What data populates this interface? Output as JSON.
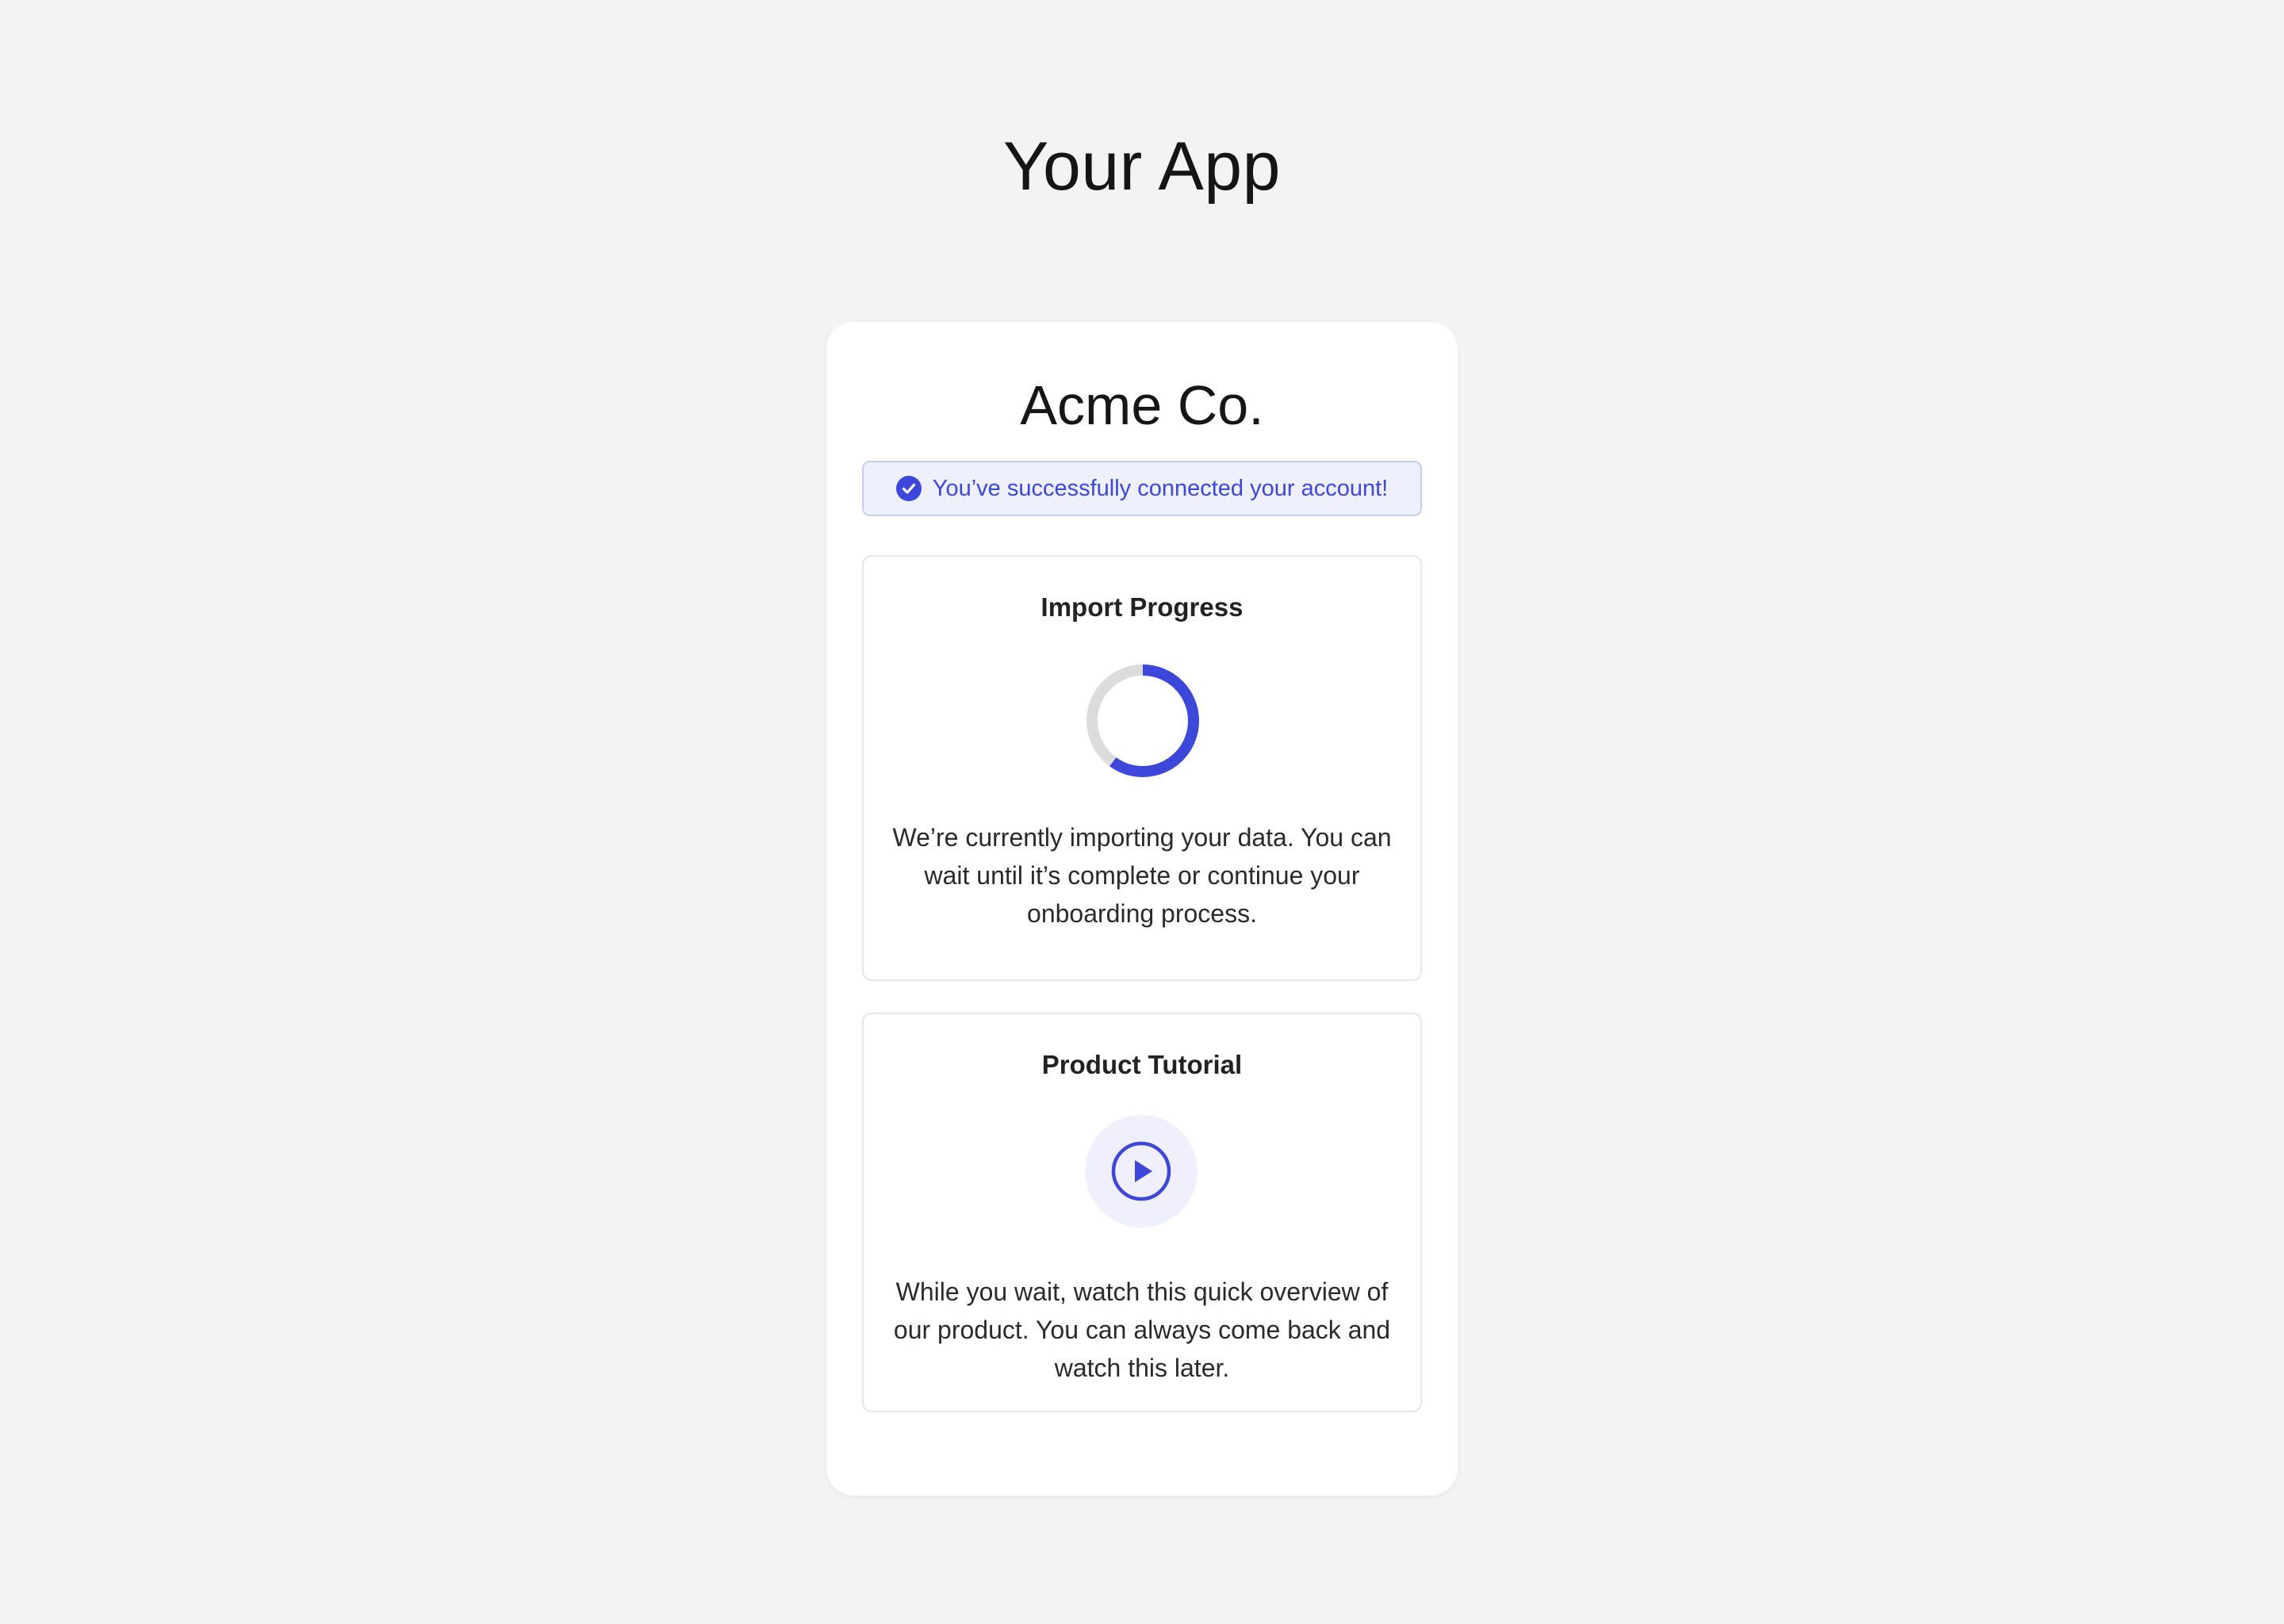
{
  "app": {
    "title": "Your App"
  },
  "card": {
    "company_name": "Acme Co.",
    "success_message": "You’ve successfully connected your account!",
    "success_icon": "check-circle-icon",
    "accent_color": "#3d47d9"
  },
  "import_progress": {
    "title": "Import Progress",
    "progress_fraction": 0.6,
    "description": "We’re currently importing your data. You can wait until it’s complete or continue your onboarding process."
  },
  "tutorial": {
    "title": "Product Tutorial",
    "icon": "play-icon",
    "description": "While you wait, watch this quick overview of our product. You can always come back and watch this later."
  }
}
